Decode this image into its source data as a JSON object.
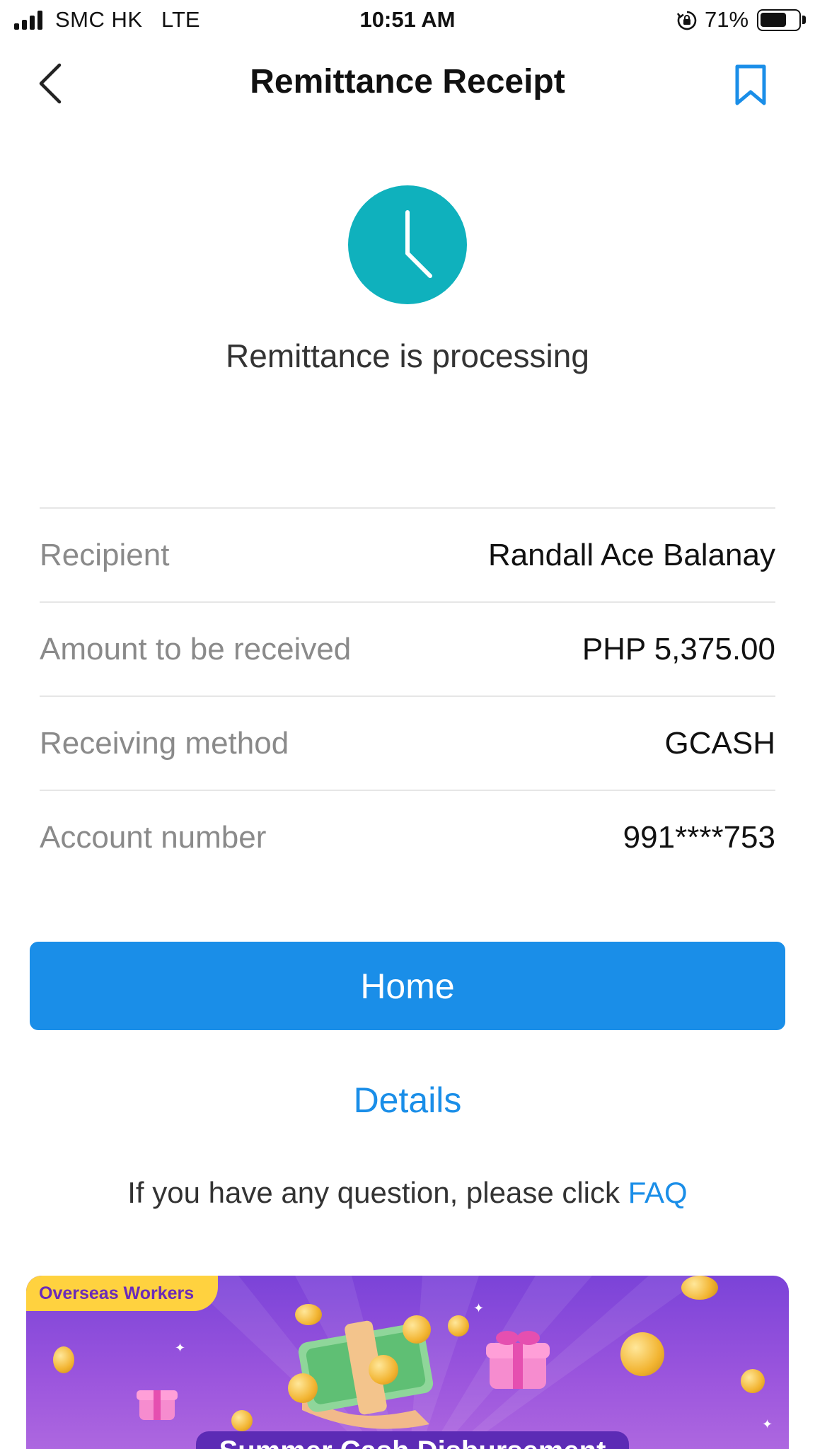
{
  "status_bar": {
    "carrier": "SMC HK",
    "network": "LTE",
    "time": "10:51 AM",
    "battery_percent_label": "71%",
    "battery_level": 0.71
  },
  "header": {
    "title": "Remittance Receipt",
    "back_icon": "chevron-left-icon",
    "bookmark_icon": "bookmark-icon"
  },
  "status": {
    "icon": "clock-icon",
    "icon_color": "#0fb1bd",
    "text": "Remittance is processing"
  },
  "details": [
    {
      "label": "Recipient",
      "value": "Randall Ace Balanay"
    },
    {
      "label": "Amount to be received",
      "value": "PHP 5,375.00"
    },
    {
      "label": "Receiving method",
      "value": "GCASH"
    },
    {
      "label": "Account number",
      "value": "991****753"
    }
  ],
  "actions": {
    "home_label": "Home",
    "details_label": "Details",
    "faq_prefix": "If you have any question, please click ",
    "faq_link": "FAQ"
  },
  "banner": {
    "tag": "Overseas Workers",
    "title": "Summer Cash Disbursement"
  },
  "colors": {
    "accent": "#1a8ee8",
    "processing": "#0fb1bd",
    "banner_purple": "#7b43d8",
    "banner_tag": "#ffd23f"
  }
}
